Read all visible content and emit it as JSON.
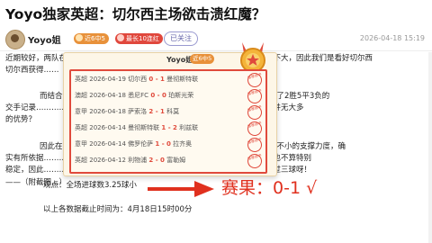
{
  "header": {
    "title": "Yoyo独家英超：切尔西主场欲击溃红魔？"
  },
  "author": {
    "name": "Yoyo姐",
    "badge_streak": "近6中5",
    "badge_best": "最长10连红",
    "follow_label": "已关注",
    "timestamp": "2026-04-18 15:19"
  },
  "article": {
    "lines_top": [
      "近期较好，两队在主场的表现……………………………………………………差距不大，因此我们是看好切尔西",
      "切尔西获得……",
      "",
      "而结合……………………………………………………对曼联的时候拿下了2胜5平3负的",
      "交手记录……………………………………………………球队或许会在心理层面上并无大多",
      "的优势？"
    ],
    "lines_mid": [
      "因此在…………………………………………………………对切尔西作出不小的支撑力度，确",
      "实有所依据……………………………………………………且结合目前的数据走势也不算特别",
      "稳定，因此……………………………………………………看好本场总进球数不超过三球呀！",
      "——（附截图…）"
    ],
    "observation": "观点：全场进球数3.25球小",
    "data_note": "以上各数据截止时间为：4月18日15时00分"
  },
  "popup": {
    "name": "Yoyo姐",
    "badge": "近6中5",
    "records": [
      {
        "league": "英超",
        "date": "2026-04-19",
        "home": "切尔西",
        "score": "0 - 1",
        "away": "曼彻斯特联"
      },
      {
        "league": "澳超",
        "date": "2026-04-18",
        "home": "悉尼FC",
        "score": "0 - 0",
        "away": "珀斯光荣"
      },
      {
        "league": "意甲",
        "date": "2026-04-18",
        "home": "萨索洛",
        "score": "2 - 1",
        "away": "科莫"
      },
      {
        "league": "英超",
        "date": "2026-04-14",
        "home": "曼彻斯特联",
        "score": "1 - 2",
        "away": "利兹联"
      },
      {
        "league": "意甲",
        "date": "2026-04-14",
        "home": "佛罗伦萨",
        "score": "1 - 0",
        "away": "拉齐奥"
      },
      {
        "league": "英超",
        "date": "2026-04-12",
        "home": "利物浦",
        "score": "2 - 0",
        "away": "富勒姆"
      }
    ],
    "stamp_text": "推荐命中"
  },
  "result": {
    "text": "赛果：0-1 √"
  },
  "colors": {
    "accent_red": "#e04a3c",
    "badge_orange": "#e8913a",
    "popup_bg": "#fdf6e7"
  }
}
